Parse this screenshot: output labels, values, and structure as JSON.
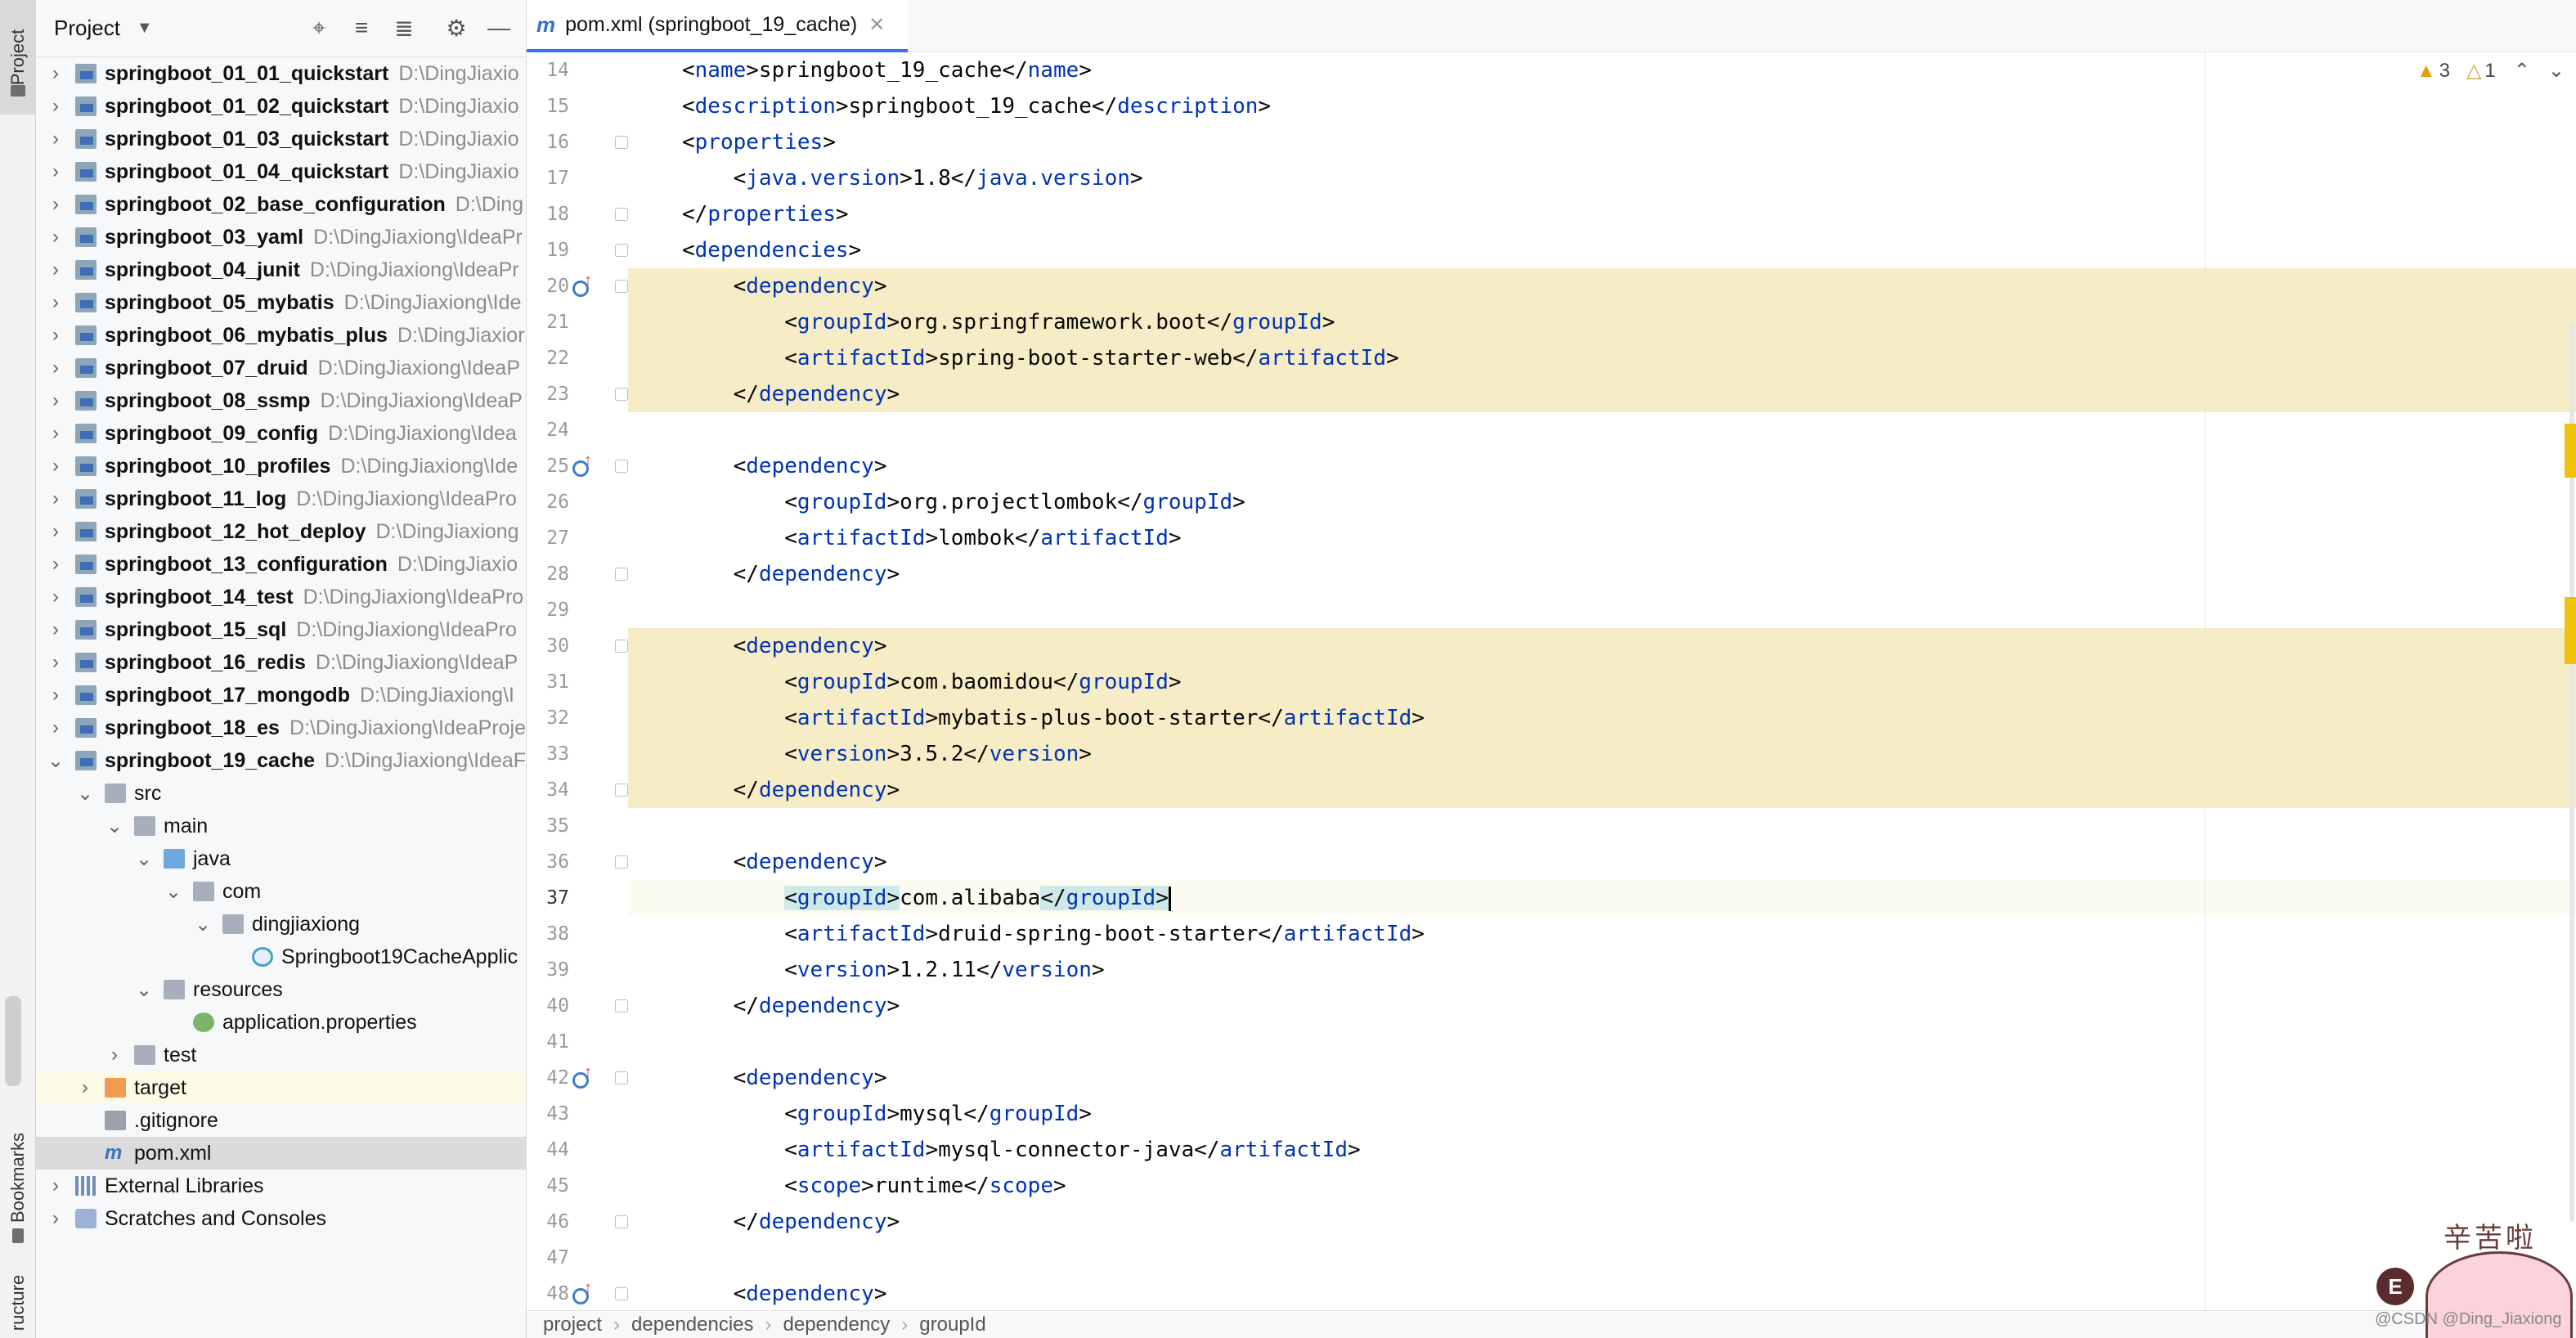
{
  "tool_strip": {
    "project_label": "Project",
    "bookmarks_label": "Bookmarks",
    "structure_label": "ructure"
  },
  "project_panel": {
    "title": "Project",
    "tree": [
      {
        "name": "springboot_01_01_quickstart",
        "path": "D:\\DingJiaxio",
        "bold": true,
        "icon": "module"
      },
      {
        "name": "springboot_01_02_quickstart",
        "path": "D:\\DingJiaxio",
        "bold": true,
        "icon": "module"
      },
      {
        "name": "springboot_01_03_quickstart",
        "path": "D:\\DingJiaxio",
        "bold": true,
        "icon": "module"
      },
      {
        "name": "springboot_01_04_quickstart",
        "path": "D:\\DingJiaxio",
        "bold": true,
        "icon": "module"
      },
      {
        "name": "springboot_02_base_configuration",
        "path": "D:\\Ding",
        "bold": true,
        "icon": "module"
      },
      {
        "name": "springboot_03_yaml",
        "path": "D:\\DingJiaxiong\\IdeaPr",
        "bold": true,
        "icon": "module"
      },
      {
        "name": "springboot_04_junit",
        "path": "D:\\DingJiaxiong\\IdeaPr",
        "bold": true,
        "icon": "module"
      },
      {
        "name": "springboot_05_mybatis",
        "path": "D:\\DingJiaxiong\\Ide",
        "bold": true,
        "icon": "module"
      },
      {
        "name": "springboot_06_mybatis_plus",
        "path": "D:\\DingJiaxior",
        "bold": true,
        "icon": "module"
      },
      {
        "name": "springboot_07_druid",
        "path": "D:\\DingJiaxiong\\IdeaP",
        "bold": true,
        "icon": "module"
      },
      {
        "name": "springboot_08_ssmp",
        "path": "D:\\DingJiaxiong\\IdeaP",
        "bold": true,
        "icon": "module"
      },
      {
        "name": "springboot_09_config",
        "path": "D:\\DingJiaxiong\\Idea",
        "bold": true,
        "icon": "module"
      },
      {
        "name": "springboot_10_profiles",
        "path": "D:\\DingJiaxiong\\Ide",
        "bold": true,
        "icon": "module"
      },
      {
        "name": "springboot_11_log",
        "path": "D:\\DingJiaxiong\\IdeaPro",
        "bold": true,
        "icon": "module"
      },
      {
        "name": "springboot_12_hot_deploy",
        "path": "D:\\DingJiaxiong",
        "bold": true,
        "icon": "module"
      },
      {
        "name": "springboot_13_configuration",
        "path": "D:\\DingJiaxio",
        "bold": true,
        "icon": "module"
      },
      {
        "name": "springboot_14_test",
        "path": "D:\\DingJiaxiong\\IdeaPro",
        "bold": true,
        "icon": "module"
      },
      {
        "name": "springboot_15_sql",
        "path": "D:\\DingJiaxiong\\IdeaPro",
        "bold": true,
        "icon": "module"
      },
      {
        "name": "springboot_16_redis",
        "path": "D:\\DingJiaxiong\\IdeaP",
        "bold": true,
        "icon": "module"
      },
      {
        "name": "springboot_17_mongodb",
        "path": "D:\\DingJiaxiong\\I",
        "bold": true,
        "icon": "module"
      },
      {
        "name": "springboot_18_es",
        "path": "D:\\DingJiaxiong\\IdeaProje",
        "bold": true,
        "icon": "module"
      },
      {
        "name": "springboot_19_cache",
        "path": "D:\\DingJiaxiong\\IdeaF",
        "bold": true,
        "icon": "module",
        "expanded": true
      },
      {
        "name": "src",
        "path": "",
        "bold": false,
        "icon": "folder",
        "expanded": true
      },
      {
        "name": "main",
        "path": "",
        "bold": false,
        "icon": "folder",
        "expanded": true
      },
      {
        "name": "java",
        "path": "",
        "bold": false,
        "icon": "folder-blue",
        "expanded": true
      },
      {
        "name": "com",
        "path": "",
        "bold": false,
        "icon": "folder",
        "expanded": true
      },
      {
        "name": "dingjiaxiong",
        "path": "",
        "bold": false,
        "icon": "folder",
        "expanded": true
      },
      {
        "name": "Springboot19CacheApplic",
        "path": "",
        "bold": false,
        "icon": "class",
        "leaf": true
      },
      {
        "name": "resources",
        "path": "",
        "bold": false,
        "icon": "folder-res",
        "expanded": true
      },
      {
        "name": "application.properties",
        "path": "",
        "bold": false,
        "icon": "props",
        "leaf": true
      },
      {
        "name": "test",
        "path": "",
        "bold": false,
        "icon": "folder"
      },
      {
        "name": "target",
        "path": "",
        "bold": false,
        "icon": "folder-orange",
        "highlight": "yellow"
      },
      {
        "name": ".gitignore",
        "path": "",
        "bold": false,
        "icon": "git",
        "leaf": true
      },
      {
        "name": "pom.xml",
        "path": "",
        "bold": false,
        "icon": "maven",
        "leaf": true,
        "selected": true
      },
      {
        "name": "External Libraries",
        "path": "",
        "bold": false,
        "icon": "lib"
      },
      {
        "name": "Scratches and Consoles",
        "path": "",
        "bold": false,
        "icon": "scratch"
      }
    ]
  },
  "editor_tab": {
    "label": "pom.xml (springboot_19_cache)"
  },
  "inspections": {
    "warnings": "3",
    "weak_warnings": "1"
  },
  "editor": {
    "lines": [
      {
        "n": "14",
        "indent": "",
        "parts": [
          [
            "tag",
            "<name"
          ],
          [
            "t",
            ">springboot_19_cache</"
          ],
          [
            "tag",
            "name"
          ],
          [
            "t",
            ">"
          ]
        ]
      },
      {
        "n": "15",
        "indent": "",
        "parts": [
          [
            "tag",
            "<description"
          ],
          [
            "t",
            ">springboot_19_cache</"
          ],
          [
            "tag",
            "description"
          ],
          [
            "t",
            ">"
          ]
        ]
      },
      {
        "n": "16",
        "indent": "",
        "parts": [
          [
            "tag",
            "<properties"
          ],
          [
            "t",
            ">"
          ]
        ]
      },
      {
        "n": "17",
        "indent": "    ",
        "parts": [
          [
            "tag",
            "<java.version"
          ],
          [
            "t",
            ">1.8</"
          ],
          [
            "tag",
            "java.version"
          ],
          [
            "t",
            ">"
          ]
        ]
      },
      {
        "n": "18",
        "indent": "",
        "parts": [
          [
            "t",
            "</"
          ],
          [
            "tag",
            "properties"
          ],
          [
            "t",
            ">"
          ]
        ]
      },
      {
        "n": "19",
        "indent": "",
        "parts": [
          [
            "tag",
            "<dependencies"
          ],
          [
            "t",
            ">"
          ]
        ]
      },
      {
        "n": "20",
        "indent": "    ",
        "parts": [
          [
            "tag",
            "<dependency"
          ],
          [
            "t",
            ">"
          ]
        ]
      },
      {
        "n": "21",
        "indent": "        ",
        "parts": [
          [
            "tag",
            "<groupId"
          ],
          [
            "t",
            ">org.springframework.boot</"
          ],
          [
            "tag",
            "groupId"
          ],
          [
            "t",
            ">"
          ]
        ]
      },
      {
        "n": "22",
        "indent": "        ",
        "parts": [
          [
            "tag",
            "<artifactId"
          ],
          [
            "t",
            ">spring-boot-starter-web</"
          ],
          [
            "tag",
            "artifactId"
          ],
          [
            "t",
            ">"
          ]
        ]
      },
      {
        "n": "23",
        "indent": "    ",
        "parts": [
          [
            "t",
            "</"
          ],
          [
            "tag",
            "dependency"
          ],
          [
            "t",
            ">"
          ]
        ]
      },
      {
        "n": "24",
        "indent": "",
        "parts": []
      },
      {
        "n": "25",
        "indent": "    ",
        "parts": [
          [
            "tag",
            "<dependency"
          ],
          [
            "t",
            ">"
          ]
        ]
      },
      {
        "n": "26",
        "indent": "        ",
        "parts": [
          [
            "tag",
            "<groupId"
          ],
          [
            "t",
            ">org.projectlombok</"
          ],
          [
            "tag",
            "groupId"
          ],
          [
            "t",
            ">"
          ]
        ]
      },
      {
        "n": "27",
        "indent": "        ",
        "parts": [
          [
            "tag",
            "<artifactId"
          ],
          [
            "t",
            ">lombok</"
          ],
          [
            "tag",
            "artifactId"
          ],
          [
            "t",
            ">"
          ]
        ]
      },
      {
        "n": "28",
        "indent": "    ",
        "parts": [
          [
            "t",
            "</"
          ],
          [
            "tag",
            "dependency"
          ],
          [
            "t",
            ">"
          ]
        ]
      },
      {
        "n": "29",
        "indent": "",
        "parts": []
      },
      {
        "n": "30",
        "indent": "    ",
        "parts": [
          [
            "tag",
            "<dependency"
          ],
          [
            "t",
            ">"
          ]
        ]
      },
      {
        "n": "31",
        "indent": "        ",
        "parts": [
          [
            "tag",
            "<groupId"
          ],
          [
            "t",
            ">com.baomidou</"
          ],
          [
            "tag",
            "groupId"
          ],
          [
            "t",
            ">"
          ]
        ]
      },
      {
        "n": "32",
        "indent": "        ",
        "parts": [
          [
            "tag",
            "<artifactId"
          ],
          [
            "t",
            ">mybatis-plus-boot-starter</"
          ],
          [
            "tag",
            "artifactId"
          ],
          [
            "t",
            ">"
          ]
        ]
      },
      {
        "n": "33",
        "indent": "        ",
        "parts": [
          [
            "tag",
            "<version"
          ],
          [
            "t",
            ">3.5.2</"
          ],
          [
            "tag",
            "version"
          ],
          [
            "t",
            ">"
          ]
        ]
      },
      {
        "n": "34",
        "indent": "    ",
        "parts": [
          [
            "t",
            "</"
          ],
          [
            "tag",
            "dependency"
          ],
          [
            "t",
            ">"
          ]
        ]
      },
      {
        "n": "35",
        "indent": "",
        "parts": []
      },
      {
        "n": "36",
        "indent": "    ",
        "parts": [
          [
            "tag",
            "<dependency"
          ],
          [
            "t",
            ">"
          ]
        ]
      },
      {
        "n": "37",
        "indent": "        ",
        "parts": [
          [
            "box",
            "<groupId>"
          ],
          [
            "t",
            "com.alibaba"
          ],
          [
            "box",
            "</groupId>"
          ],
          [
            "caret",
            ""
          ]
        ]
      },
      {
        "n": "38",
        "indent": "        ",
        "parts": [
          [
            "tag",
            "<artifactId"
          ],
          [
            "t",
            ">druid-spring-boot-starter</"
          ],
          [
            "tag",
            "artifactId"
          ],
          [
            "t",
            ">"
          ]
        ]
      },
      {
        "n": "39",
        "indent": "        ",
        "parts": [
          [
            "tag",
            "<version"
          ],
          [
            "t",
            ">1.2.11</"
          ],
          [
            "tag",
            "version"
          ],
          [
            "t",
            ">"
          ]
        ]
      },
      {
        "n": "40",
        "indent": "    ",
        "parts": [
          [
            "t",
            "</"
          ],
          [
            "tag",
            "dependency"
          ],
          [
            "t",
            ">"
          ]
        ]
      },
      {
        "n": "41",
        "indent": "",
        "parts": []
      },
      {
        "n": "42",
        "indent": "    ",
        "parts": [
          [
            "tag",
            "<dependency"
          ],
          [
            "t",
            ">"
          ]
        ]
      },
      {
        "n": "43",
        "indent": "        ",
        "parts": [
          [
            "tag",
            "<groupId"
          ],
          [
            "t",
            ">mysql</"
          ],
          [
            "tag",
            "groupId"
          ],
          [
            "t",
            ">"
          ]
        ]
      },
      {
        "n": "44",
        "indent": "        ",
        "parts": [
          [
            "tag",
            "<artifactId"
          ],
          [
            "t",
            ">mysql-connector-java</"
          ],
          [
            "tag",
            "artifactId"
          ],
          [
            "t",
            ">"
          ]
        ]
      },
      {
        "n": "45",
        "indent": "        ",
        "parts": [
          [
            "tag",
            "<scope"
          ],
          [
            "t",
            ">runtime</"
          ],
          [
            "tag",
            "scope"
          ],
          [
            "t",
            ">"
          ]
        ]
      },
      {
        "n": "46",
        "indent": "    ",
        "parts": [
          [
            "t",
            "</"
          ],
          [
            "tag",
            "dependency"
          ],
          [
            "t",
            ">"
          ]
        ]
      },
      {
        "n": "47",
        "indent": "",
        "parts": []
      },
      {
        "n": "48",
        "indent": "    ",
        "parts": [
          [
            "tag",
            "<dependency"
          ],
          [
            "t",
            ">"
          ]
        ]
      }
    ]
  },
  "breadcrumb": [
    "project",
    "dependencies",
    "dependency",
    "groupId"
  ],
  "watermark": {
    "sticker_text": "辛苦啦",
    "sticker_badge": "E",
    "credit": "@CSDN @Ding_Jiaxiong"
  },
  "colors": {
    "tag": "#0033b3",
    "highlight": "#f6ecc5",
    "selection": "#dbdbdb",
    "accent": "#3574f0"
  }
}
